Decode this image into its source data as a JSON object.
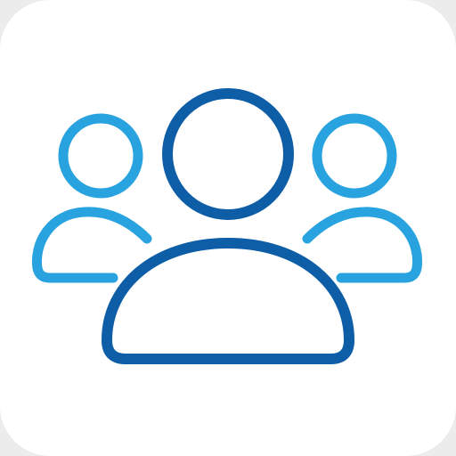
{
  "icon": {
    "name": "group-users-icon",
    "colors": {
      "background": "#ffffff",
      "primary_outline": "#0d5ea6",
      "secondary_outline": "#29a3df"
    }
  }
}
